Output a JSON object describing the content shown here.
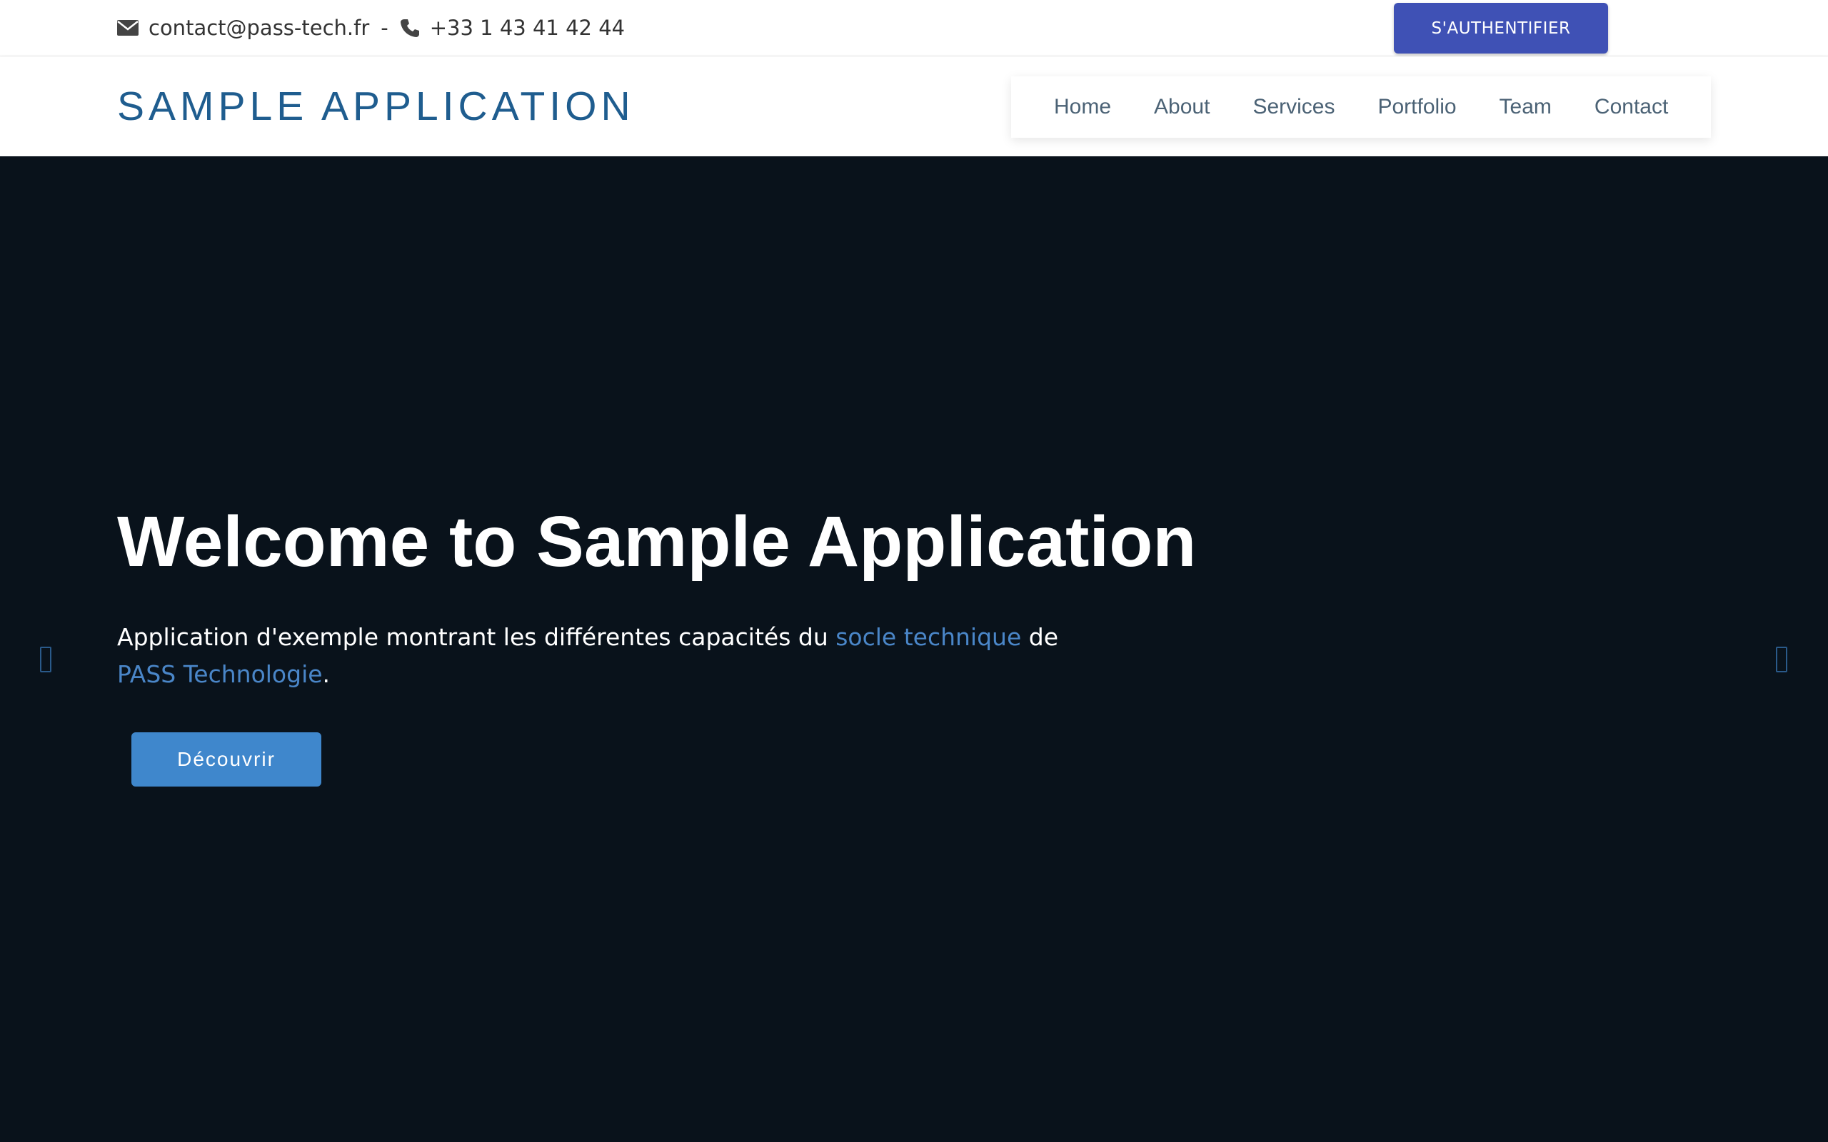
{
  "topbar": {
    "email": "contact@pass-tech.fr",
    "separator": "-",
    "phone": "+33 1 43 41 42 44",
    "auth_label": "S'AUTHENTIFIER",
    "accent_color": "#3f51b5"
  },
  "header": {
    "brand": "SAMPLE APPLICATION",
    "brand_color": "#1f5d8f",
    "nav": [
      "Home",
      "About",
      "Services",
      "Portfolio",
      "Team",
      "Contact"
    ]
  },
  "hero": {
    "title": "Welcome to Sample Application",
    "desc_part1": "Application d'exemple montrant les différentes capacités du ",
    "link1": "socle technique",
    "desc_part2": " de",
    "link2": "PASS Technologie",
    "desc_end": ".",
    "button_label": "Découvrir",
    "background_color": "#09121b",
    "link_color": "#4a86c8",
    "icons": {
      "prev": "chevron-left-icon",
      "next": "chevron-right-icon"
    }
  }
}
